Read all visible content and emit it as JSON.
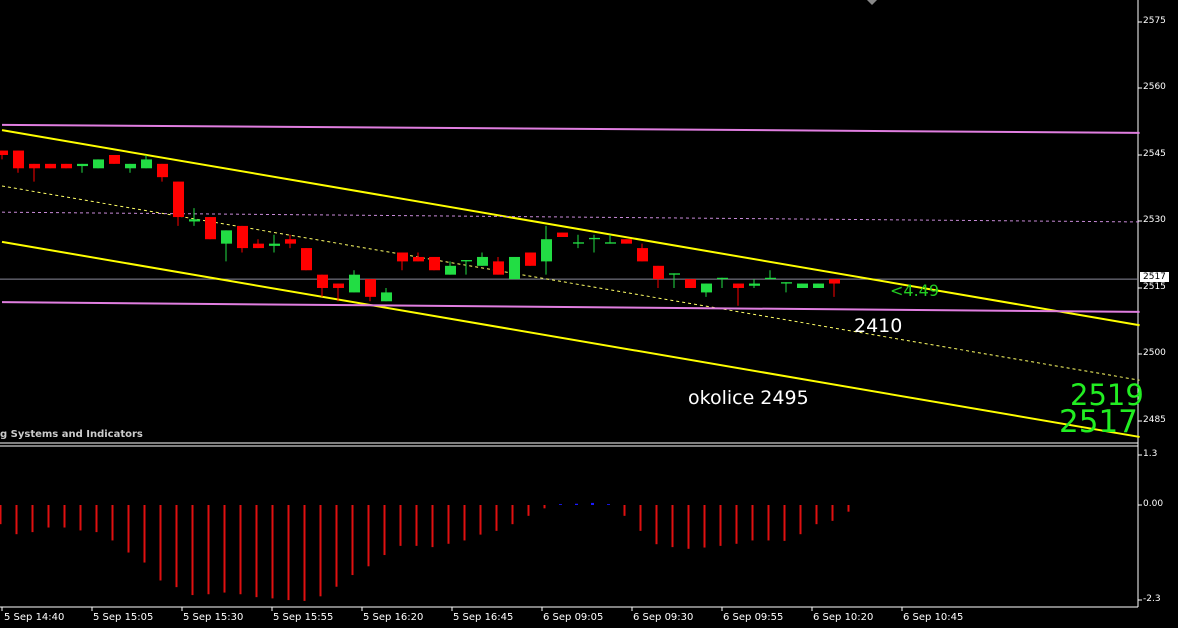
{
  "chart_data": {
    "type": "candlestick",
    "indicator_caption": "g Systems and Indicators",
    "price_axis": {
      "ticks": [
        "2575",
        "2560",
        "2545",
        "2530",
        "2515",
        "2500",
        "2485"
      ],
      "range": [
        2483,
        2580
      ],
      "current_price_label": "2517",
      "current_price": 2517
    },
    "x_axis": {
      "ticks": [
        "5 Sep 14:40",
        "5 Sep 15:05",
        "5 Sep 15:30",
        "5 Sep 15:55",
        "5 Sep 16:20",
        "5 Sep 16:45",
        "6 Sep 09:05",
        "6 Sep 09:30",
        "6 Sep 09:55",
        "6 Sep 10:20",
        "6 Sep 10:45"
      ]
    },
    "candles_ohlc": [
      [
        2546,
        2546,
        2544,
        2545
      ],
      [
        2546,
        2546,
        2541,
        2542
      ],
      [
        2543,
        2543,
        2539,
        2542
      ],
      [
        2543,
        2543,
        2542,
        2542
      ],
      [
        2543,
        2543,
        2542,
        2542
      ],
      [
        2542.5,
        2543,
        2541,
        2543
      ],
      [
        2542,
        2544,
        2542,
        2544
      ],
      [
        2545,
        2545,
        2543,
        2543
      ],
      [
        2542,
        2543,
        2541,
        2543
      ],
      [
        2542,
        2545,
        2542,
        2544
      ],
      [
        2543,
        2543,
        2539,
        2540
      ],
      [
        2539,
        2539,
        2529,
        2531
      ],
      [
        2530,
        2533,
        2529,
        2530.5
      ],
      [
        2531,
        2531,
        2526,
        2526
      ],
      [
        2525,
        2528,
        2521,
        2528
      ],
      [
        2529,
        2529,
        2523,
        2524
      ],
      [
        2525,
        2526,
        2524,
        2524
      ],
      [
        2524.5,
        2527,
        2523,
        2525
      ],
      [
        2526,
        2527,
        2524,
        2525
      ],
      [
        2524,
        2524,
        2519,
        2519
      ],
      [
        2518,
        2518,
        2513,
        2515
      ],
      [
        2516,
        2516,
        2512,
        2515
      ],
      [
        2514,
        2519,
        2514,
        2518
      ],
      [
        2517,
        2517,
        2512,
        2513
      ],
      [
        2512,
        2515,
        2512,
        2514
      ],
      [
        2523,
        2523,
        2519,
        2521
      ],
      [
        2522,
        2523,
        2521,
        2521
      ],
      [
        2522,
        2522,
        2519,
        2519
      ],
      [
        2518,
        2521,
        2518,
        2520
      ],
      [
        2521,
        2521.3,
        2518,
        2521.3
      ],
      [
        2520,
        2523,
        2520,
        2522
      ],
      [
        2521,
        2522,
        2518,
        2518
      ],
      [
        2517,
        2522,
        2517,
        2522
      ],
      [
        2523,
        2523,
        2520,
        2520
      ],
      [
        2521,
        2529,
        2518,
        2526
      ],
      [
        2527.5,
        2527.5,
        2526.5,
        2526.5
      ],
      [
        2525,
        2527,
        2524,
        2525.3
      ],
      [
        2526,
        2527,
        2523,
        2526.3
      ],
      [
        2525,
        2527,
        2525,
        2525.3
      ],
      [
        2526,
        2526,
        2525,
        2525
      ],
      [
        2524,
        2525,
        2521,
        2521
      ],
      [
        2520,
        2520,
        2515,
        2517
      ],
      [
        2518,
        2518.3,
        2515,
        2518.3
      ],
      [
        2517,
        2517,
        2515,
        2515
      ],
      [
        2514,
        2516,
        2513,
        2516
      ],
      [
        2517,
        2517.3,
        2515,
        2517.3
      ],
      [
        2516,
        2516,
        2511,
        2515
      ],
      [
        2515.5,
        2517,
        2515,
        2516
      ],
      [
        2517,
        2519,
        2517,
        2517.3
      ],
      [
        2516,
        2516.3,
        2514,
        2516.3
      ],
      [
        2515,
        2516,
        2515,
        2516
      ],
      [
        2515,
        2516,
        2515,
        2516
      ],
      [
        2517,
        2517,
        2513,
        2516
      ]
    ],
    "lines": [
      {
        "name": "channel-upper",
        "color": "#ffff00",
        "style": "solid",
        "from": [
          0,
          2550.6
        ],
        "to": [
          71.1,
          2506.6
        ]
      },
      {
        "name": "channel-middle",
        "color": "#ffff66",
        "style": "dashed",
        "from": [
          0,
          2538.0
        ],
        "to": [
          71.1,
          2494.2
        ]
      },
      {
        "name": "channel-lower",
        "color": "#ffff00",
        "style": "solid",
        "from": [
          0,
          2525.4
        ],
        "to": [
          71.1,
          2481.4
        ]
      },
      {
        "name": "level-upper",
        "color": "#e07ee0",
        "style": "solid",
        "from": [
          0,
          2551.8
        ],
        "to": [
          71.1,
          2550.0
        ]
      },
      {
        "name": "level-mid",
        "color": "#c88ad8",
        "style": "dashed",
        "from": [
          0,
          2532.1
        ],
        "to": [
          71.1,
          2529.9
        ]
      },
      {
        "name": "level-lower",
        "color": "#e07ee0",
        "style": "solid",
        "from": [
          0,
          2511.8
        ],
        "to": [
          71.1,
          2509.6
        ]
      }
    ],
    "annotations": [
      {
        "text": "<4.49",
        "color": "#22cc22"
      },
      {
        "text": "2410",
        "color": "#ffffff"
      },
      {
        "text": "okolice 2495",
        "color": "#ffffff"
      },
      {
        "text": "2519",
        "color": "#22ee22"
      },
      {
        "text": "2517",
        "color": "#22ee22"
      }
    ],
    "indicator": {
      "ticks": [
        "1.3",
        "0.00",
        "-2.3"
      ],
      "range": [
        -2.3,
        1.3
      ],
      "values": [
        -0.46,
        -0.7,
        -0.65,
        -0.54,
        -0.54,
        -0.61,
        -0.65,
        -0.85,
        -1.14,
        -1.38,
        -1.81,
        -1.97,
        -2.16,
        -2.14,
        -2.1,
        -2.14,
        -2.21,
        -2.24,
        -2.28,
        -2.3,
        -2.19,
        -1.96,
        -1.68,
        -1.47,
        -1.2,
        -0.98,
        -0.98,
        -1.01,
        -0.93,
        -0.85,
        -0.71,
        -0.62,
        -0.46,
        -0.26,
        -0.08,
        0.02,
        0.03,
        0.05,
        0.02,
        -0.26,
        -0.62,
        -0.94,
        -1.01,
        -1.05,
        -1.02,
        -0.98,
        -0.93,
        -0.85,
        -0.85,
        -0.86,
        -0.7,
        -0.46,
        -0.38,
        -0.16
      ],
      "up_color": "#1a1aff",
      "down_color": "#e01010"
    },
    "colors": {
      "bull": "#22dd44",
      "bear": "#ff0000",
      "background": "#000000"
    }
  }
}
